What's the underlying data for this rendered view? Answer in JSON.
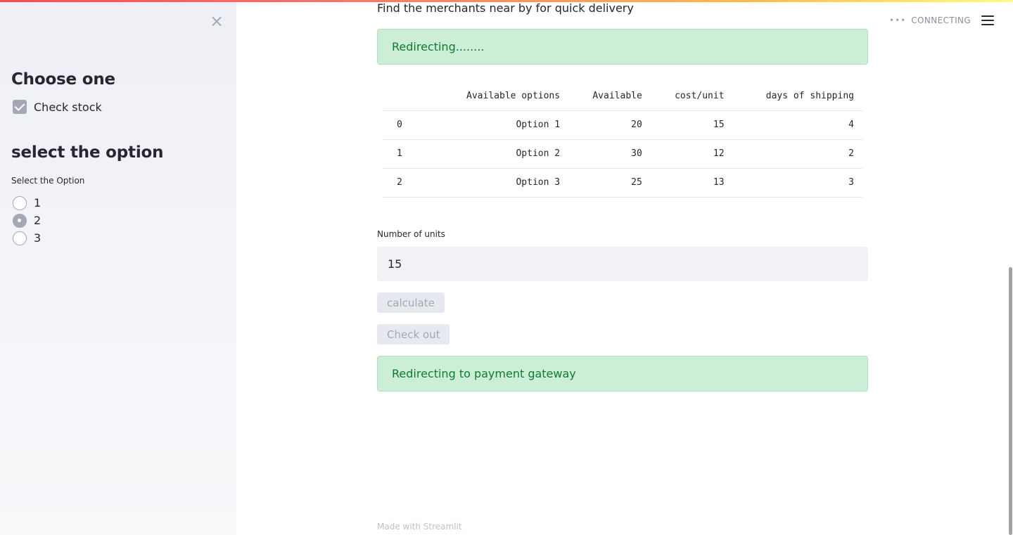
{
  "sidebar": {
    "close_icon": "×",
    "choose_heading": "Choose one",
    "checkbox": {
      "label": "Check stock",
      "checked": true
    },
    "select_heading": "select the option",
    "radio_label": "Select the Option",
    "radio_options": [
      "1",
      "2",
      "3"
    ],
    "radio_selected": "2"
  },
  "header": {
    "status_dots": "•••",
    "status_text": "CONNECTING",
    "menu_icon": "hamburger-menu-icon"
  },
  "main": {
    "subtitle": "Find the merchants near by for quick delivery",
    "alert_top": "Redirecting........",
    "table": {
      "columns": [
        "",
        "Available options",
        "Available",
        "cost/unit",
        "days of shipping"
      ],
      "rows": [
        [
          "0",
          "Option 1",
          "20",
          "15",
          "4"
        ],
        [
          "1",
          "Option 2",
          "30",
          "12",
          "2"
        ],
        [
          "2",
          "Option 3",
          "25",
          "13",
          "3"
        ]
      ]
    },
    "units_label": "Number of units",
    "units_value": "15",
    "calculate_label": "calculate",
    "checkout_label": "Check out",
    "alert_bottom": "Redirecting to payment gateway",
    "footer": "Made with Streamlit"
  },
  "colors": {
    "alert_bg": "#cdeed6",
    "alert_text": "#0e7a32",
    "sidebar_bg": "#eef0f5",
    "accent_gray": "#a3a8b4"
  }
}
